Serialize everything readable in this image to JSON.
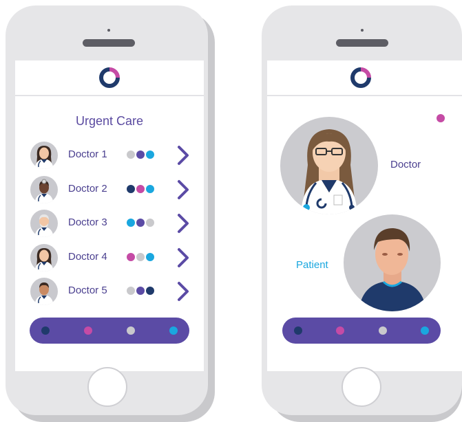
{
  "colors": {
    "navy": "#1f3a6b",
    "purple": "#5b4ba5",
    "pink": "#c54ba5",
    "cyan": "#1aa7df",
    "gray": "#c9c9cc",
    "text": "#4a3f8f",
    "patient_label": "#1aa7df"
  },
  "left_screen": {
    "title": "Urgent Care",
    "doctors": [
      {
        "name": "Doctor 1",
        "status_dots": [
          "gray",
          "purple",
          "cyan"
        ],
        "avatar_icon": "female-doctor-icon"
      },
      {
        "name": "Doctor 2",
        "status_dots": [
          "navy",
          "pink",
          "cyan"
        ],
        "avatar_icon": "doctor-with-head-mirror-icon"
      },
      {
        "name": "Doctor 3",
        "status_dots": [
          "cyan",
          "purple",
          "gray"
        ],
        "avatar_icon": "older-doctor-icon"
      },
      {
        "name": "Doctor 4",
        "status_dots": [
          "pink",
          "gray",
          "cyan"
        ],
        "avatar_icon": "female-doctor-icon"
      },
      {
        "name": "Doctor 5",
        "status_dots": [
          "gray",
          "purple",
          "navy"
        ],
        "avatar_icon": "male-doctor-icon"
      }
    ],
    "nav_dots": [
      "navy",
      "pink",
      "gray",
      "cyan"
    ]
  },
  "right_screen": {
    "doctor_label": "Doctor",
    "patient_label": "Patient",
    "indicator": "pink",
    "nav_dots": [
      "navy",
      "pink",
      "gray",
      "cyan"
    ]
  },
  "icons": {
    "logo": "circle-logo-icon",
    "chevron": "chevron-right-icon"
  }
}
